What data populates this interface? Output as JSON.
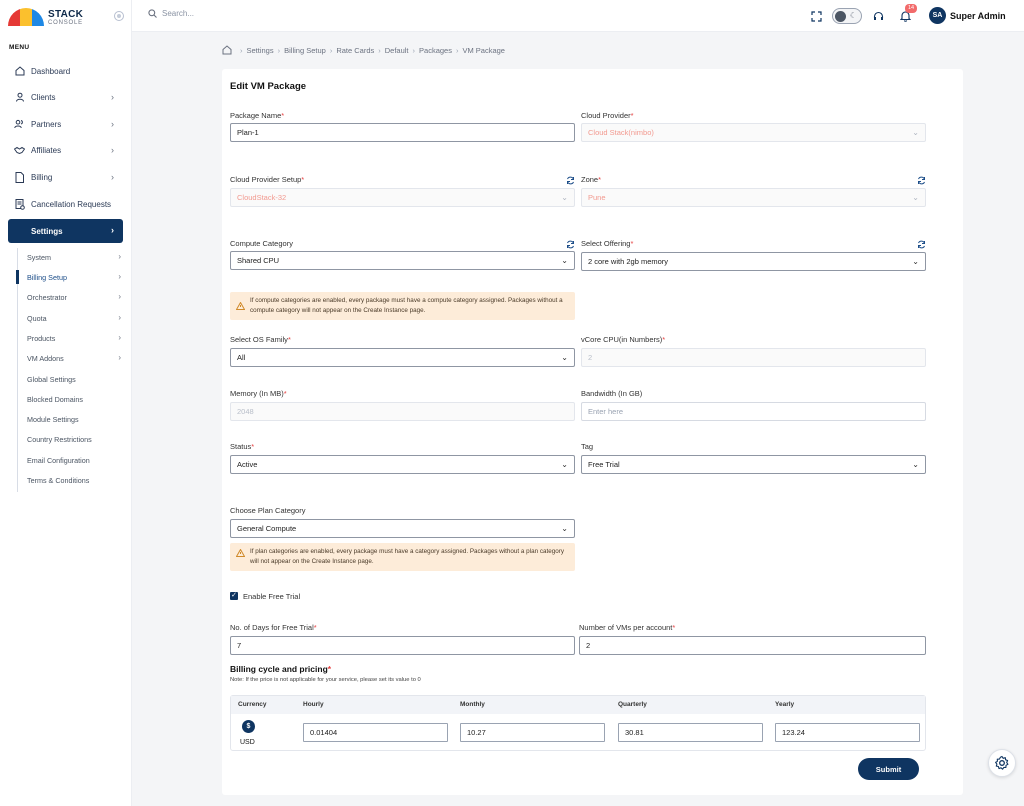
{
  "brand": {
    "name": "STACK",
    "sub": "CONSOLE"
  },
  "sidebar": {
    "menu_label": "MENU",
    "items": [
      {
        "label": "Dashboard",
        "icon": "home-icon"
      },
      {
        "label": "Clients",
        "icon": "user-icon"
      },
      {
        "label": "Partners",
        "icon": "users-icon"
      },
      {
        "label": "Affiliates",
        "icon": "handshake-icon"
      },
      {
        "label": "Billing",
        "icon": "document-icon"
      },
      {
        "label": "Cancellation Requests",
        "icon": "receipt-icon"
      },
      {
        "label": "Settings",
        "icon": "",
        "active": true
      }
    ],
    "sub_items": [
      {
        "label": "System"
      },
      {
        "label": "Billing Setup",
        "active": true
      },
      {
        "label": "Orchestrator"
      },
      {
        "label": "Quota"
      },
      {
        "label": "Products"
      },
      {
        "label": "VM Addons"
      },
      {
        "label": "Global Settings"
      },
      {
        "label": "Blocked Domains"
      },
      {
        "label": "Module Settings"
      },
      {
        "label": "Country Restrictions"
      },
      {
        "label": "Email Configuration"
      },
      {
        "label": "Terms & Conditions"
      }
    ]
  },
  "topbar": {
    "search_placeholder": "Search...",
    "notifications_count": "14",
    "user_initials": "SA",
    "user_name": "Super Admin"
  },
  "breadcrumb": [
    "Settings",
    "Billing Setup",
    "Rate Cards",
    "Default",
    "Packages",
    "VM Package"
  ],
  "form": {
    "title": "Edit VM Package",
    "package_name": {
      "label": "Package Name",
      "value": "Plan-1"
    },
    "cloud_provider": {
      "label": "Cloud Provider",
      "value": "Cloud Stack(nimbo)"
    },
    "cloud_provider_setup": {
      "label": "Cloud Provider Setup",
      "value": "CloudStack-32"
    },
    "zone": {
      "label": "Zone",
      "value": "Pune"
    },
    "compute_category": {
      "label": "Compute Category",
      "value": "Shared CPU"
    },
    "select_offering": {
      "label": "Select Offering",
      "value": "2 core with 2gb memory"
    },
    "compute_notice": "If compute categories are enabled, every package must have a compute category assigned. Packages without a compute category will not appear on the Create Instance page.",
    "os_family": {
      "label": "Select OS Family",
      "value": "All"
    },
    "vcore": {
      "label": "vCore CPU(in Numbers)",
      "value": "2"
    },
    "memory": {
      "label": "Memory (In MB)",
      "value": "2048"
    },
    "bandwidth": {
      "label": "Bandwidth (In GB)",
      "placeholder": "Enter here"
    },
    "status": {
      "label": "Status",
      "value": "Active"
    },
    "tag": {
      "label": "Tag",
      "value": "Free Trial"
    },
    "plan_category": {
      "label": "Choose Plan Category",
      "value": "General Compute"
    },
    "plan_notice": "If plan categories are enabled, every package must have a category assigned. Packages without a plan category will not appear on the Create Instance page.",
    "enable_free_trial": {
      "label": "Enable Free Trial",
      "checked": true
    },
    "free_trial_days": {
      "label": "No. of Days for Free Trial",
      "value": "7"
    },
    "vms_per_account": {
      "label": "Number of VMs per account",
      "value": "2"
    },
    "pricing": {
      "title": "Billing cycle and pricing",
      "note": "Note: If the price is not applicable for your service, please set its value to 0",
      "headers": [
        "Currency",
        "Hourly",
        "Monthly",
        "Quarterly",
        "Yearly"
      ],
      "currency": "USD",
      "hourly": "0.01404",
      "monthly": "10.27",
      "quarterly": "30.81",
      "yearly": "123.24"
    },
    "submit_label": "Submit"
  },
  "colors": {
    "primary": "#0f3561",
    "required": "#e53e3e",
    "notice_bg": "#fdecd9"
  }
}
